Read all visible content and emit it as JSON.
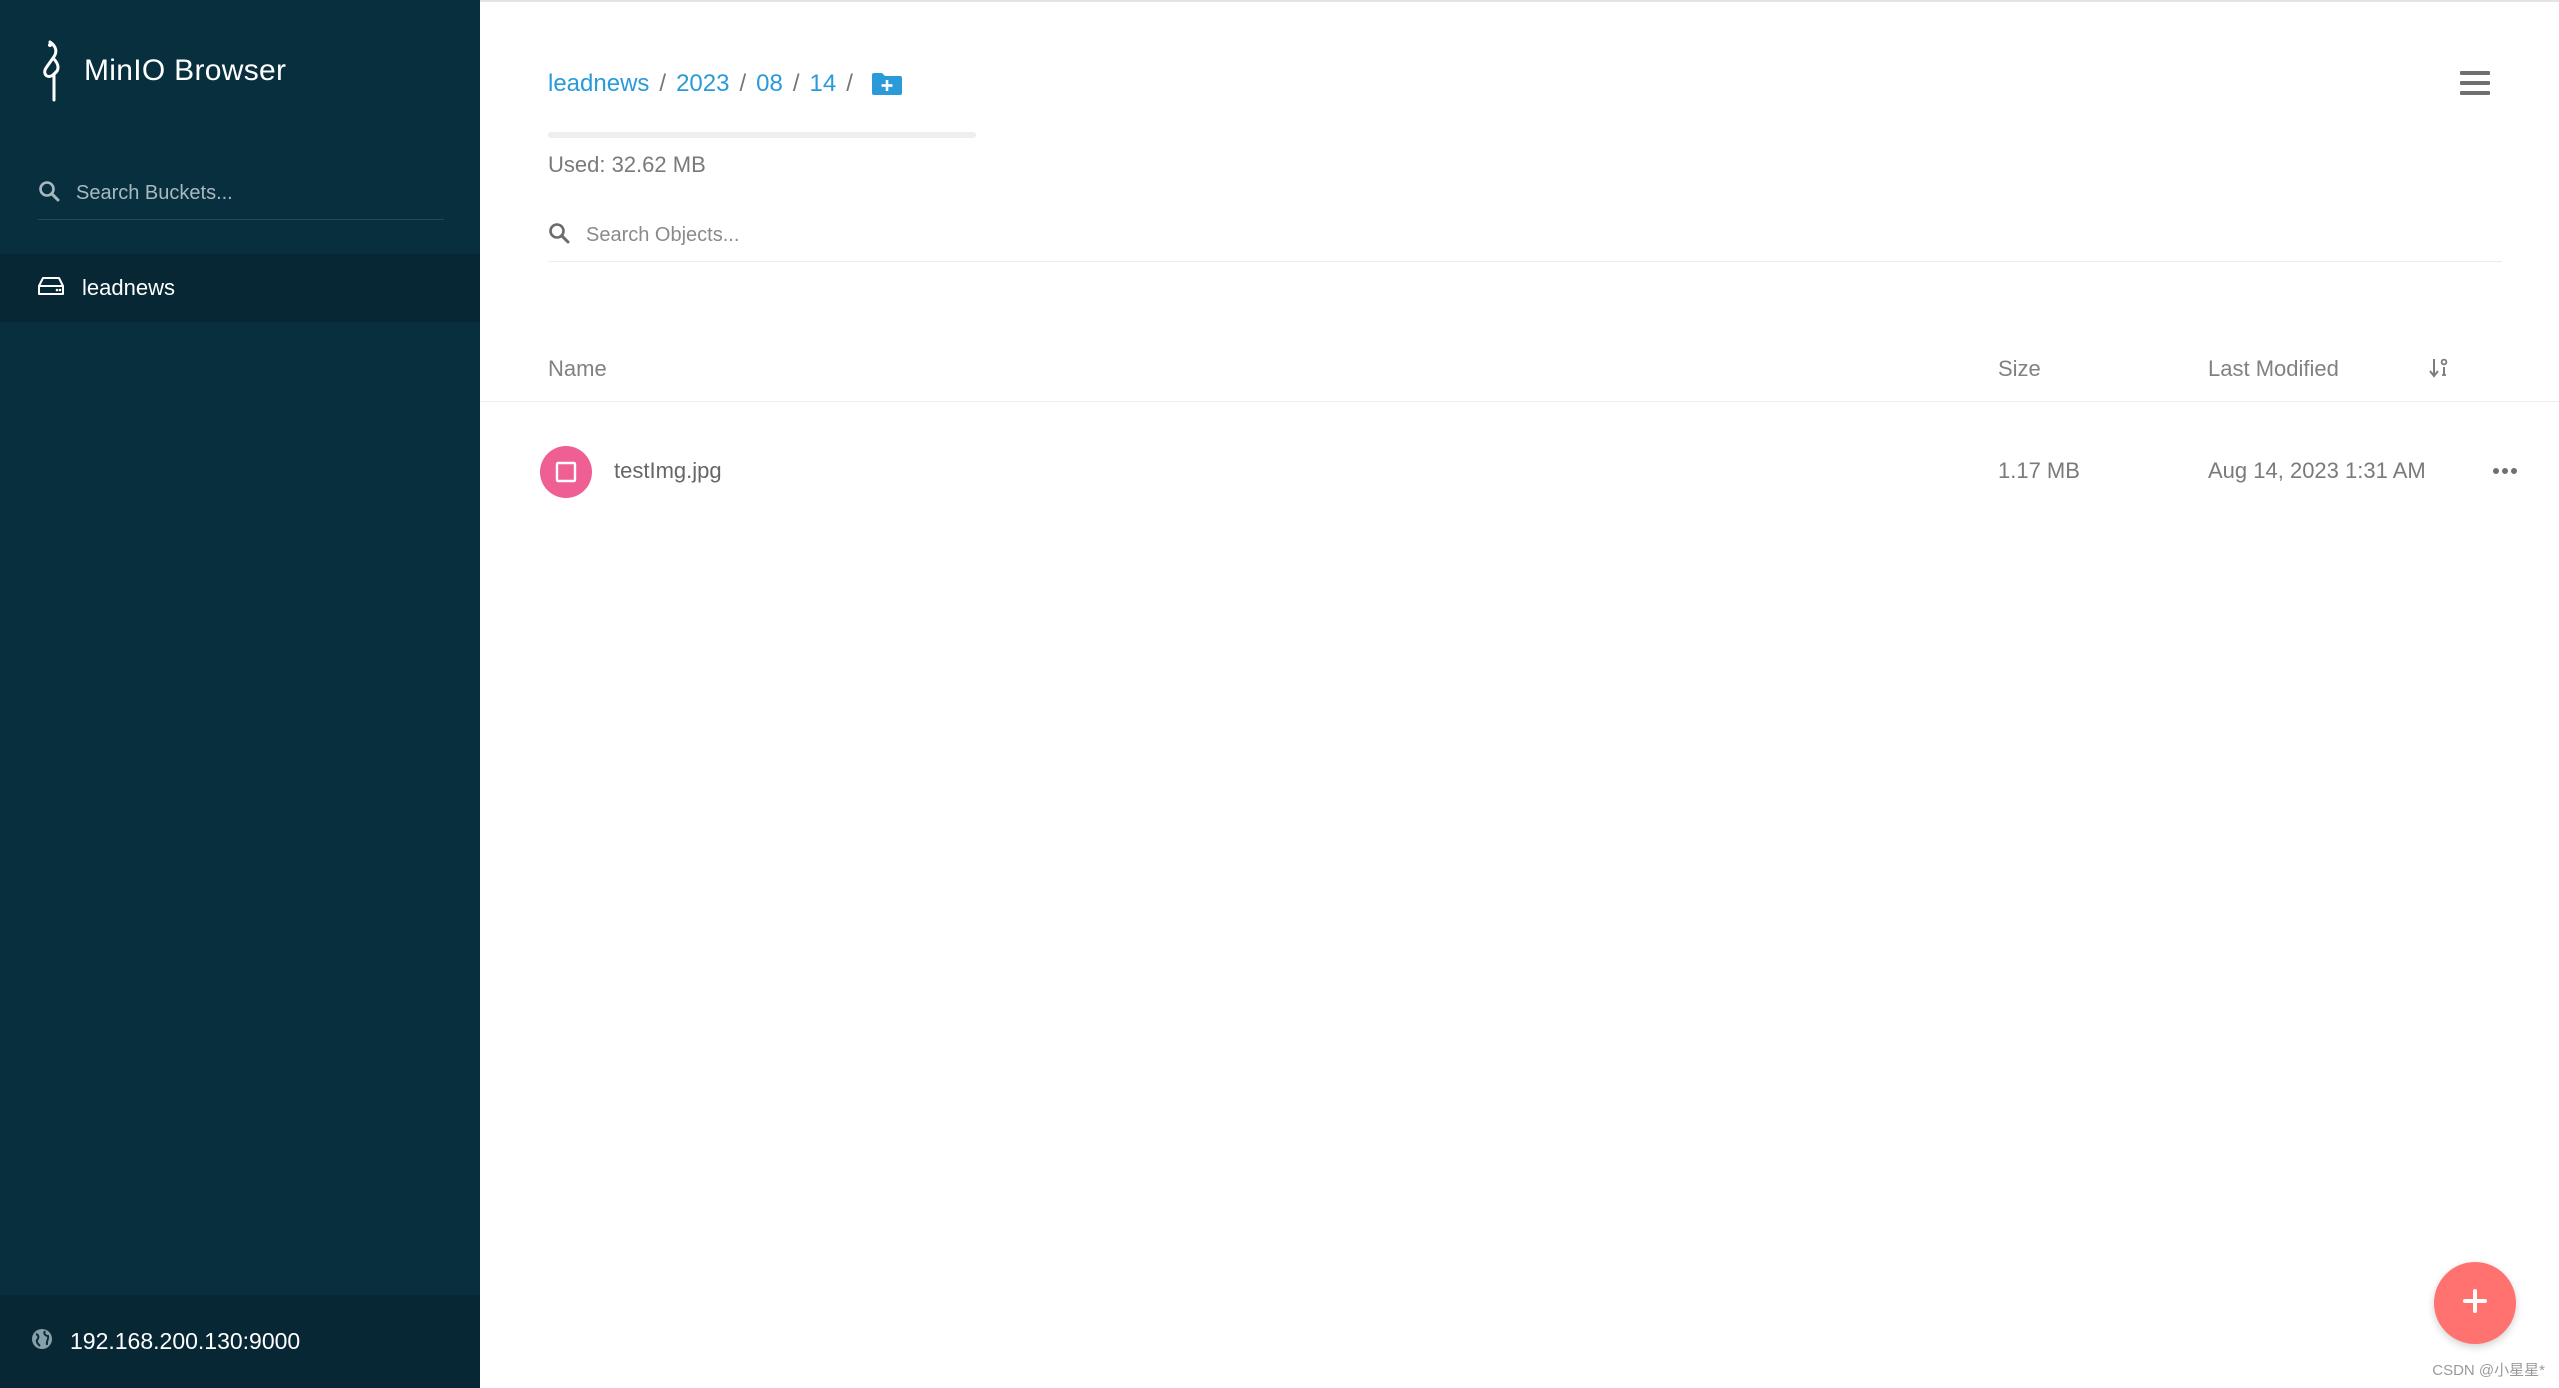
{
  "app": {
    "title": "MinIO Browser"
  },
  "sidebar": {
    "search_placeholder": "Search Buckets...",
    "buckets": [
      {
        "label": "leadnews"
      }
    ],
    "host": "192.168.200.130:9000"
  },
  "main": {
    "breadcrumb": [
      "leadnews",
      "2023",
      "08",
      "14"
    ],
    "breadcrumb_separator": "/",
    "usage": {
      "label": "Used: 32.62 MB",
      "fraction": 0
    },
    "search_placeholder": "Search Objects...",
    "columns": {
      "name": "Name",
      "size": "Size",
      "modified": "Last Modified"
    },
    "objects": [
      {
        "name": "testImg.jpg",
        "size": "1.17 MB",
        "modified": "Aug 14, 2023 1:31 AM"
      }
    ]
  },
  "watermark": "CSDN @小星星*",
  "colors": {
    "sidebar_bg": "#082f3d",
    "link": "#2a9ad9",
    "file_icon": "#ef5f93",
    "fab": "#ff726f"
  },
  "icons": {
    "logo": "minio-bird-icon",
    "bucket_search": "search-icon",
    "bucket": "hard-drive-icon",
    "host": "globe-icon",
    "add_folder": "folder-plus-icon",
    "menu": "hamburger-menu-icon",
    "object_search": "search-icon",
    "sort": "sort-icon",
    "file": "image-file-icon",
    "row_actions": "more-horizontal-icon",
    "fab": "plus-icon"
  }
}
